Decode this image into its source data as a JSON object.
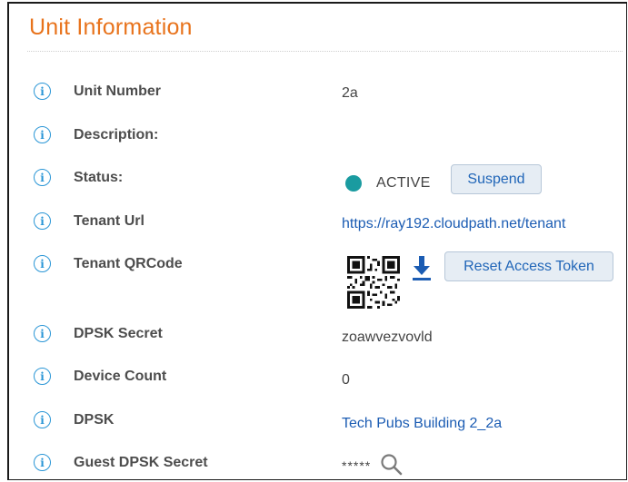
{
  "header": {
    "title": "Unit Information"
  },
  "rows": {
    "unit_number": {
      "label": "Unit Number",
      "value": "2a"
    },
    "description": {
      "label": "Description:",
      "value": ""
    },
    "status": {
      "label": "Status:",
      "value": "ACTIVE",
      "status_color": "#1a9ba0",
      "button": "Suspend"
    },
    "tenant_url": {
      "label": "Tenant Url",
      "value": "https://ray192.cloudpath.net/tenant"
    },
    "tenant_qrcode": {
      "label": "Tenant QRCode",
      "button": "Reset Access Token"
    },
    "dpsk_secret": {
      "label": "DPSK Secret",
      "value": "zoawvezvovld"
    },
    "device_count": {
      "label": "Device Count",
      "value": "0"
    },
    "dpsk": {
      "label": "DPSK",
      "value": "Tech Pubs Building 2_2a"
    },
    "guest_dpsk_secret": {
      "label": "Guest DPSK Secret",
      "value": "*****"
    }
  },
  "icons": {
    "info": "info-circle-icon",
    "download": "download-icon",
    "search": "search-icon",
    "qr": "qr-code-image"
  },
  "colors": {
    "title": "#e8731c",
    "info_icon": "#2a96d6",
    "link": "#1b5cb3",
    "button_text": "#2166b8"
  }
}
